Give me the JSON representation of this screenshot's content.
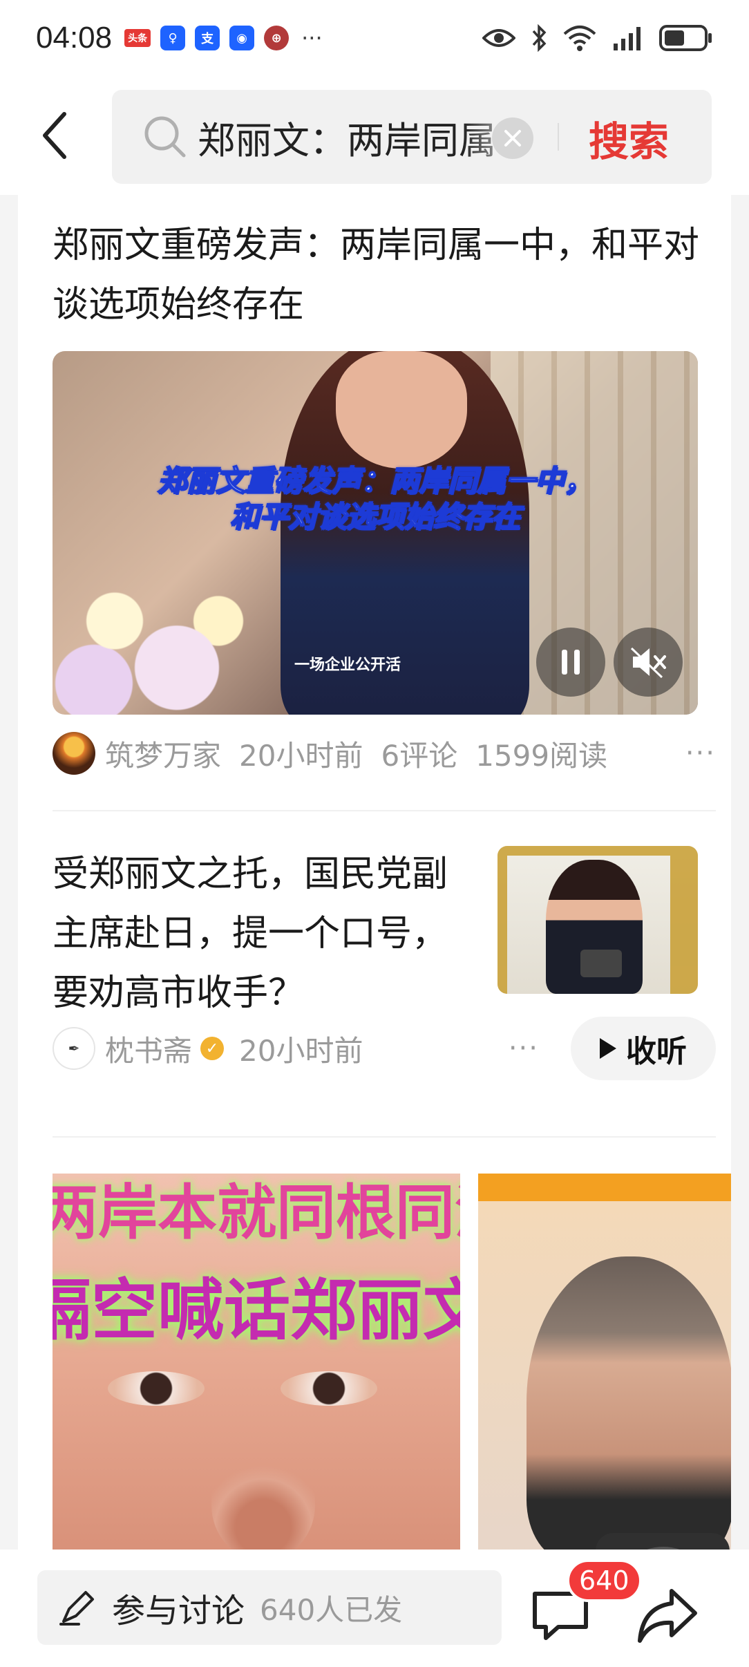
{
  "status_bar": {
    "time": "04:08",
    "notif_badges": [
      "头条",
      "♀",
      "支",
      "◉",
      "⊕"
    ],
    "more": "···"
  },
  "search": {
    "query": "郑丽文：两岸同属一中，和平对谈选项始终存在",
    "button_label": "搜索"
  },
  "articles": [
    {
      "title": "郑丽文重磅发声：两岸同属一中，和平对谈选项始终存在",
      "video_caption_line1": "郑丽文重磅发声：两岸同属一中，",
      "video_caption_line2": "和平对谈选项始终存在",
      "video_subtitle": "一场企业公开活",
      "author": "筑梦万家",
      "time": "20小时前",
      "comments": "6评论",
      "reads": "1599阅读",
      "more": "···"
    },
    {
      "title": "受郑丽文之托，国民党副主席赴日，提一个口号，要劝高市收手？",
      "author": "枕书斋",
      "time": "20小时前",
      "more": "···",
      "listen_label": "收听"
    }
  ],
  "image_row": {
    "left_banner_line1": "两岸本就同根同源",
    "left_banner_line2": "隔空喊话郑丽文知行"
  },
  "bottom_bar": {
    "discuss_label": "参与讨论",
    "discuss_count": "640人已发",
    "comment_badge": "640"
  },
  "colors": {
    "accent_red": "#e53935",
    "badge_red": "#f23a3a",
    "muted_text": "#9a9a9a"
  }
}
